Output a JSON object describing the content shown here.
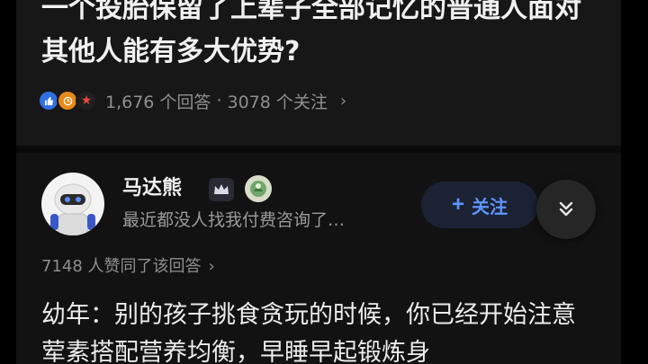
{
  "question": {
    "title": "一个投胎保留了上辈子全部记忆的普通人面对其他人能有多大优势?",
    "answer_count": "1,676 个回答",
    "separator": "·",
    "follower_count": "3078 个关注",
    "badge_icons": [
      "thumbs-up-icon",
      "clock-icon",
      "star-icon"
    ],
    "badge_colors": [
      "#2f6fe4",
      "#e88a1a",
      "#e8473e"
    ]
  },
  "author": {
    "name": "马达熊",
    "bio": "最近都没人找我付费咨询了…",
    "follow_label": "关注",
    "follow_icon": "+"
  },
  "answer": {
    "votes": "7148 人赞同了该回答",
    "text": "幼年：别的孩子挑食贪玩的时候，你已经开始注意荤素搭配营养均衡，早睡早起锻炼身"
  },
  "colors": {
    "accent": "#5e95ff",
    "background": "#121212"
  }
}
